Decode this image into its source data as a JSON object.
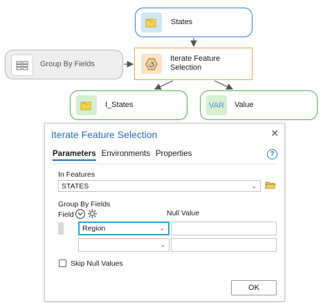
{
  "diagram": {
    "states": {
      "label": "States"
    },
    "iterate": {
      "label": "Iterate Feature Selection"
    },
    "group_by": {
      "label": "Group By Fields"
    },
    "i_states": {
      "label": "I_States"
    },
    "value": {
      "label": "Value",
      "var_text": "VAR"
    }
  },
  "dialog": {
    "title": "Iterate Feature Selection",
    "close_glyph": "✕",
    "tabs": [
      {
        "label": "Parameters",
        "active": true
      },
      {
        "label": "Environments",
        "active": false
      },
      {
        "label": "Properties",
        "active": false
      }
    ],
    "help_glyph": "?",
    "in_features": {
      "label": "In Features",
      "value": "STATES"
    },
    "group_by_fields": {
      "label": "Group By Fields",
      "field_header": "Field",
      "null_value_header": "Null Value",
      "rows": [
        {
          "field": "Region",
          "null_value": ""
        },
        {
          "field": "",
          "null_value": ""
        }
      ]
    },
    "skip_null": {
      "label": "Skip Null Values",
      "checked": false
    },
    "ok_label": "OK"
  },
  "colors": {
    "accent": "#2b6cb0",
    "focus": "#1fa7d8",
    "data_node": "#2f7fc8",
    "tool_node": "#e8a24a",
    "output_node": "#4cae4c"
  }
}
